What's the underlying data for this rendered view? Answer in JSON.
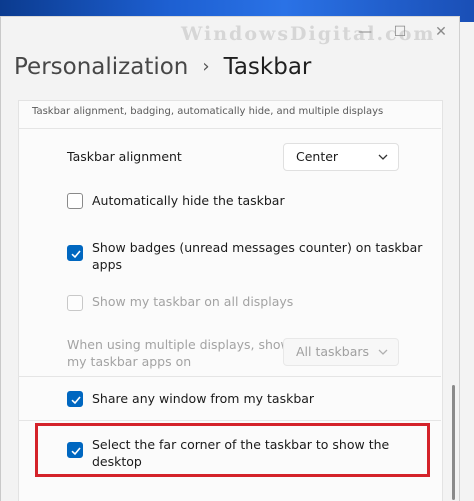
{
  "watermark": "WindowsDigital.com",
  "window": {
    "minimize_glyph": "—",
    "maximize_glyph": "☐",
    "close_glyph": "✕"
  },
  "breadcrumb": {
    "parent": "Personalization",
    "separator": "›",
    "current": "Taskbar"
  },
  "section": {
    "description": "Taskbar alignment, badging, automatically hide, and multiple displays"
  },
  "settings": {
    "alignment": {
      "label": "Taskbar alignment",
      "value": "Center"
    },
    "auto_hide": {
      "label": "Automatically hide the taskbar",
      "checked": false
    },
    "badges": {
      "label_line1": "Show badges (unread messages counter) on taskbar",
      "label_line2": "apps",
      "checked": true
    },
    "all_displays": {
      "label": "Show my taskbar on all displays",
      "checked": false,
      "disabled": true
    },
    "multi_display": {
      "label_line1": "When using multiple displays, show",
      "label_line2": "my taskbar apps on",
      "value": "All taskbars",
      "disabled": true
    },
    "share_window": {
      "label": "Share any window from my taskbar",
      "checked": true
    },
    "far_corner": {
      "label_line1": "Select the far corner of the taskbar to show the",
      "label_line2": "desktop",
      "checked": true
    }
  },
  "colors": {
    "accent": "#0067c0",
    "highlight_box": "#d4232a"
  }
}
